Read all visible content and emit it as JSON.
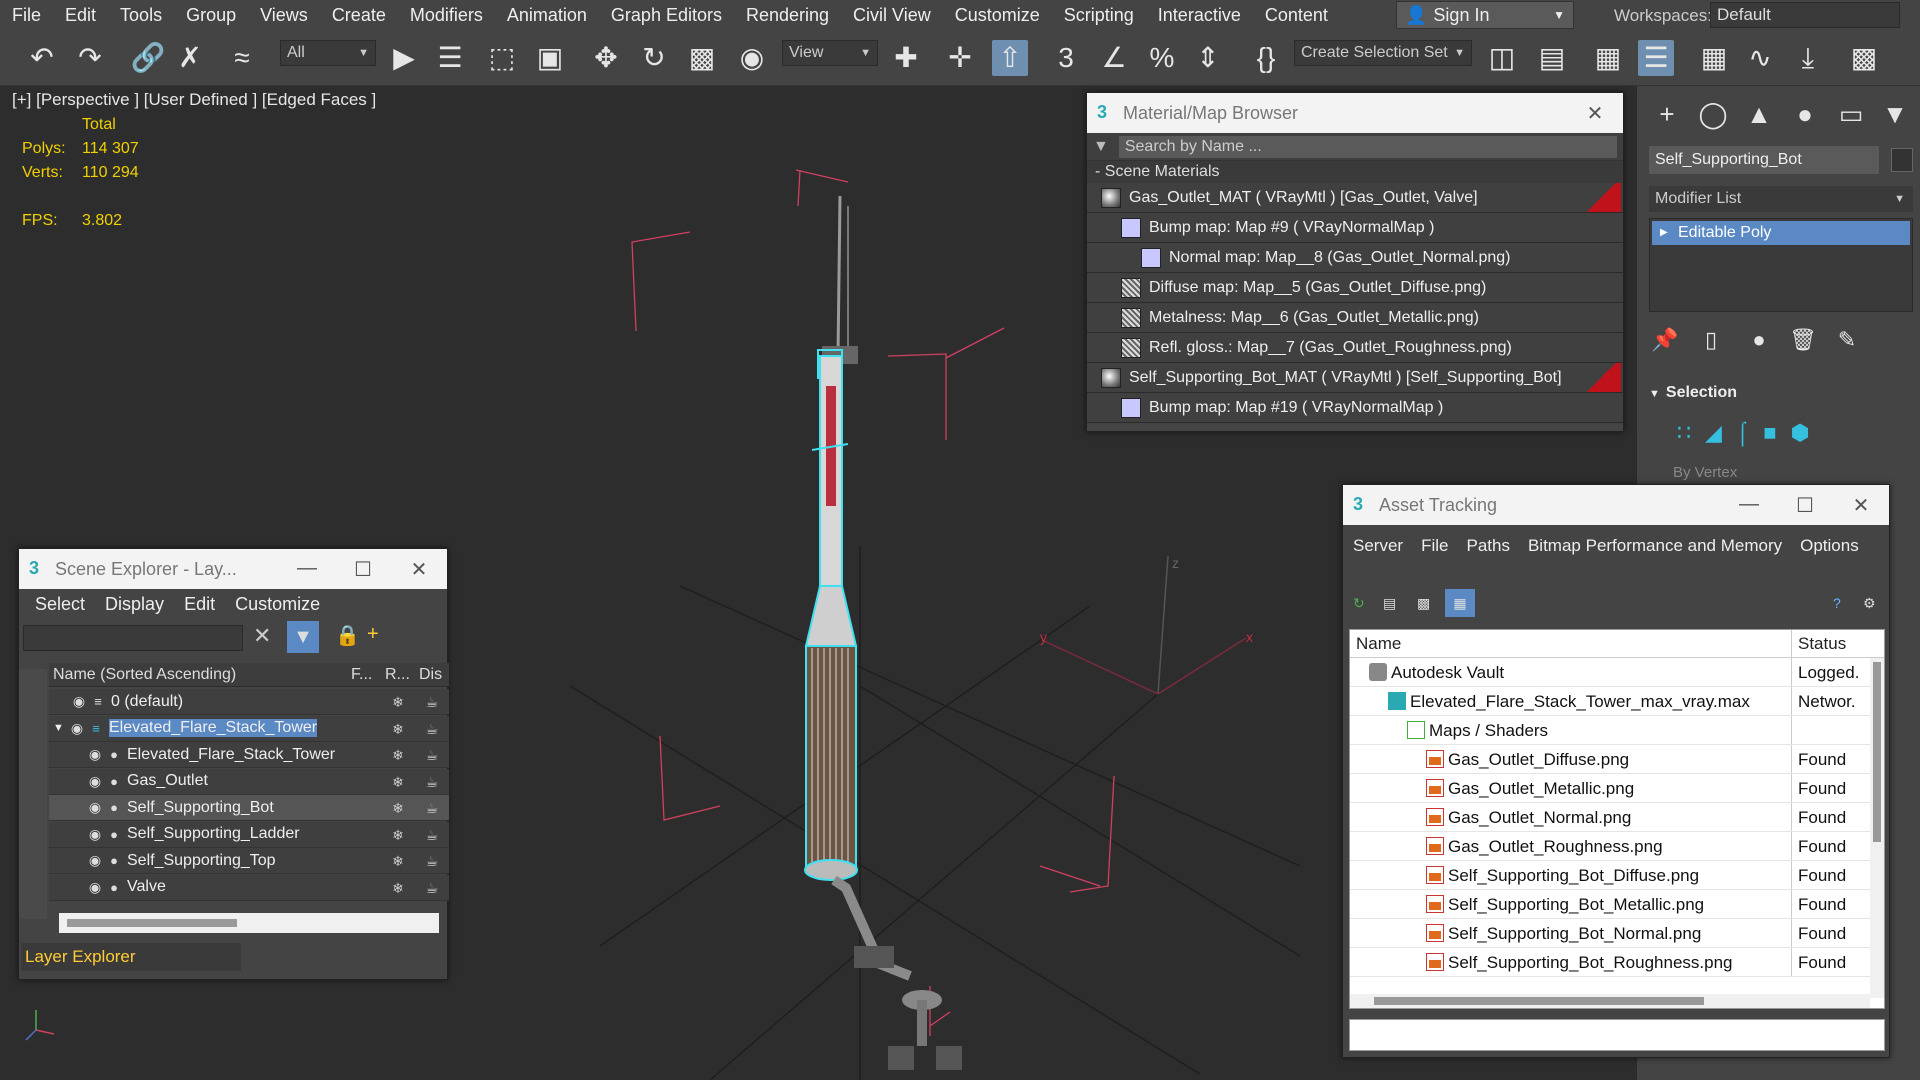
{
  "menubar": {
    "items": [
      "File",
      "Edit",
      "Tools",
      "Group",
      "Views",
      "Create",
      "Modifiers",
      "Animation",
      "Graph Editors",
      "Rendering",
      "Civil View",
      "Customize",
      "Scripting",
      "Interactive",
      "Content"
    ],
    "sign_in": "Sign In",
    "workspaces_label": "Workspaces:",
    "workspace_value": "Default"
  },
  "toolbar": {
    "filter_value": "All",
    "view_value": "View",
    "selection_set": "Create Selection Set"
  },
  "viewport": {
    "label": "[+] [Perspective ] [User Defined ] [Edged Faces ]",
    "total_label": "Total",
    "polys_label": "Polys:",
    "polys_value": "114 307",
    "verts_label": "Verts:",
    "verts_value": "110 294",
    "fps_label": "FPS:",
    "fps_value": "3.802",
    "axis_z": "z",
    "axis_y": "y",
    "axis_x": "x"
  },
  "material_browser": {
    "title": "Material/Map Browser",
    "search_placeholder": "Search by Name ...",
    "section": "- Scene Materials",
    "rows": [
      {
        "label": "Gas_Outlet_MAT  ( VRayMtl )  [Gas_Outlet, Valve]",
        "swatch": "sphere",
        "indent": 0,
        "flag": true
      },
      {
        "label": "Bump map: Map #9  ( VRayNormalMap )",
        "swatch": "lavender",
        "indent": 1
      },
      {
        "label": "Normal map: Map__8 (Gas_Outlet_Normal.png)",
        "swatch": "lavender",
        "indent": 2
      },
      {
        "label": "Diffuse map: Map__5 (Gas_Outlet_Diffuse.png)",
        "swatch": "noise",
        "indent": 1
      },
      {
        "label": "Metalness: Map__6 (Gas_Outlet_Metallic.png)",
        "swatch": "noise",
        "indent": 1
      },
      {
        "label": "Refl. gloss.: Map__7 (Gas_Outlet_Roughness.png)",
        "swatch": "noise",
        "indent": 1
      },
      {
        "label": "Self_Supporting_Bot_MAT  ( VRayMtl )  [Self_Supporting_Bot]",
        "swatch": "sphere",
        "indent": 0,
        "flag": true
      },
      {
        "label": "Bump map: Map #19  ( VRayNormalMap )",
        "swatch": "lavender",
        "indent": 1
      }
    ]
  },
  "command_panel": {
    "object_name": "Self_Supporting_Bot",
    "modifier_list": "Modifier List",
    "modifier": "Editable Poly",
    "selection_heading": "Selection",
    "by_vertex": "By Vertex"
  },
  "scene_explorer": {
    "title": "Scene Explorer - Lay...",
    "menu": [
      "Select",
      "Display",
      "Edit",
      "Customize"
    ],
    "col_name": "Name (Sorted Ascending)",
    "col_f": "F...",
    "col_r": "R...",
    "col_dis": "Dis",
    "rows": [
      {
        "name": "0 (default)",
        "indent": 1,
        "type": "layer"
      },
      {
        "name": "Elevated_Flare_Stack_Tower",
        "indent": 0,
        "type": "layer-active"
      },
      {
        "name": "Elevated_Flare_Stack_Tower",
        "indent": 2,
        "type": "object"
      },
      {
        "name": "Gas_Outlet",
        "indent": 2,
        "type": "object"
      },
      {
        "name": "Self_Supporting_Bot",
        "indent": 2,
        "type": "object",
        "selected": true
      },
      {
        "name": "Self_Supporting_Ladder",
        "indent": 2,
        "type": "object"
      },
      {
        "name": "Self_Supporting_Top",
        "indent": 2,
        "type": "object"
      },
      {
        "name": "Valve",
        "indent": 2,
        "type": "object"
      }
    ],
    "footer": "Layer Explorer"
  },
  "asset_tracking": {
    "title": "Asset Tracking",
    "menu": [
      "Server",
      "File",
      "Paths",
      "Bitmap Performance and Memory",
      "Options"
    ],
    "col_name": "Name",
    "col_status": "Status",
    "rows": [
      {
        "name": "Autodesk Vault",
        "status": "Logged.",
        "indent": 1,
        "icon": "vault"
      },
      {
        "name": "Elevated_Flare_Stack_Tower_max_vray.max",
        "status": "Networ.",
        "indent": 2,
        "icon": "max"
      },
      {
        "name": "Maps / Shaders",
        "status": "",
        "indent": 3,
        "icon": "maps"
      },
      {
        "name": "Gas_Outlet_Diffuse.png",
        "status": "Found",
        "indent": 4,
        "icon": "png"
      },
      {
        "name": "Gas_Outlet_Metallic.png",
        "status": "Found",
        "indent": 4,
        "icon": "png"
      },
      {
        "name": "Gas_Outlet_Normal.png",
        "status": "Found",
        "indent": 4,
        "icon": "png"
      },
      {
        "name": "Gas_Outlet_Roughness.png",
        "status": "Found",
        "indent": 4,
        "icon": "png"
      },
      {
        "name": "Self_Supporting_Bot_Diffuse.png",
        "status": "Found",
        "indent": 4,
        "icon": "png"
      },
      {
        "name": "Self_Supporting_Bot_Metallic.png",
        "status": "Found",
        "indent": 4,
        "icon": "png"
      },
      {
        "name": "Self_Supporting_Bot_Normal.png",
        "status": "Found",
        "indent": 4,
        "icon": "png"
      },
      {
        "name": "Self_Supporting_Bot_Roughness.png",
        "status": "Found",
        "indent": 4,
        "icon": "png"
      }
    ]
  },
  "colors": {
    "accent": "#5b89c4",
    "stats": "#f0d000",
    "selection_wire": "#3fe0f0",
    "material_flag": "#c0121a"
  }
}
